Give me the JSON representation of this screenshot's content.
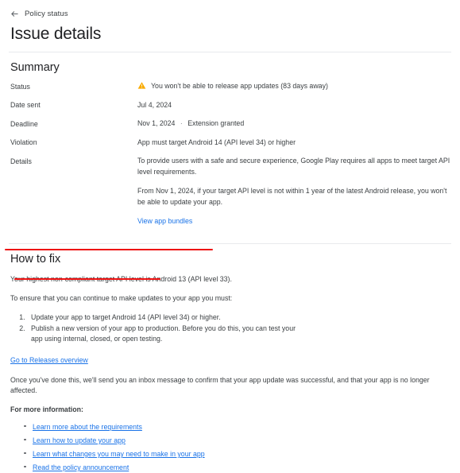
{
  "nav": {
    "back_icon": "arrow-left-icon",
    "back_label": "Policy status"
  },
  "header": {
    "title": "Issue details"
  },
  "summary": {
    "section_title": "Summary",
    "rows": [
      {
        "label": "Status",
        "icon": "warning-triangle-icon",
        "value": "You won't be able to release app updates (83 days away)"
      },
      {
        "label": "Date sent",
        "value": "Jul 4, 2024"
      },
      {
        "label": "Deadline",
        "value": "Nov 1, 2024",
        "separator": "·",
        "extra": "Extension granted"
      },
      {
        "label": "Violation",
        "value": "App must target Android 14 (API level 34) or higher"
      },
      {
        "label": "Details",
        "paragraphs": [
          "To provide users with a safe and secure experience, Google Play requires all apps to meet target API level requirements.",
          "From Nov 1, 2024, if your target API level is not within 1 year of the latest Android release, you won't be able to update your app."
        ],
        "link": "View app bundles"
      }
    ]
  },
  "how_to_fix": {
    "section_title": "How to fix",
    "highlight_line": "Your highest non-compliant target API level is Android 13 (API level 33).",
    "intro": "To ensure that you can continue to make updates to your app you must:",
    "steps": [
      "Update your app to target Android 14 (API level 34) or higher.",
      "Publish a new version of your app to production. Before you do this, you can test your app using internal, closed, or open testing."
    ],
    "releases_link": "Go to Releases overview",
    "confirmation": "Once you've done this, we'll send you an inbox message to confirm that your app update was successful, and that your app is no longer affected.",
    "more_info_label": "For more information:",
    "info_links": [
      "Learn more about the requirements",
      "Learn how to update your app",
      "Learn what changes you may need to make in your app",
      "Read the policy announcement"
    ]
  },
  "annotations": {
    "color": "#ee1111",
    "underlines": [
      "Your highest non-compliant target API level is Android 13 (API level 33).",
      "Update your app to target Android 14 (API level 34) or higher."
    ]
  },
  "colors": {
    "link": "#1a73e8",
    "warning": "#f9ab00",
    "text": "#3c4043",
    "divider": "#e8eaed"
  }
}
